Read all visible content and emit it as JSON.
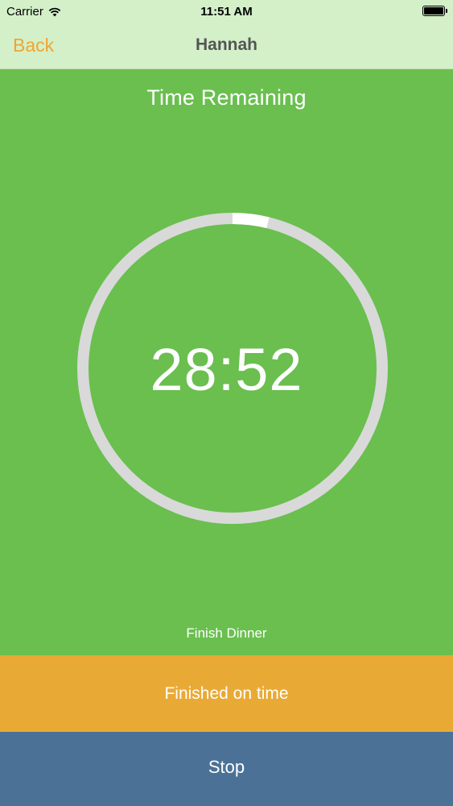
{
  "status_bar": {
    "carrier": "Carrier",
    "time": "11:51 AM",
    "wifi_icon": "wifi-icon",
    "battery_icon": "battery-icon"
  },
  "nav": {
    "back_label": "Back",
    "title": "Hannah"
  },
  "timer": {
    "heading": "Time Remaining",
    "time": "28:52",
    "elapsed_fraction": 0.038,
    "task": "Finish Dinner"
  },
  "actions": {
    "finished_label": "Finished on time",
    "stop_label": "Stop"
  },
  "colors": {
    "background": "#6abf4f",
    "nav_background": "#d3f0c9",
    "back_accent": "#f0a530",
    "finish_button": "#e9aa35",
    "stop_button": "#4b7296",
    "ring_track": "#d9d9d9",
    "ring_progress": "#ffffff"
  }
}
